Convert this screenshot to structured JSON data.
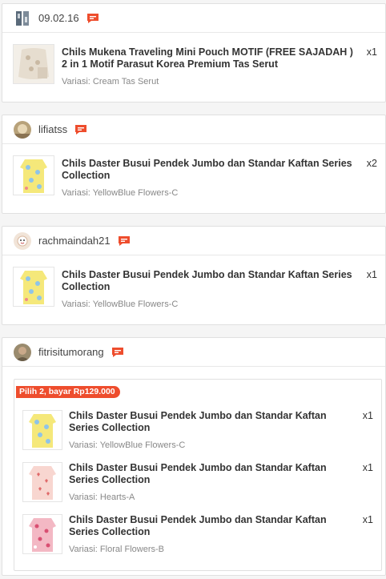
{
  "orders": [
    {
      "username": "09.02.16",
      "items": [
        {
          "name": "Chils Mukena Traveling Mini Pouch MOTIF (FREE SAJADAH ) 2 in 1 Motif Parasut Korea Premium Tas Serut",
          "qty": "x1",
          "variant": "Variasi: Cream Tas Serut"
        }
      ]
    },
    {
      "username": "lifiatss",
      "items": [
        {
          "name": "Chils Daster Busui Pendek Jumbo dan Standar Kaftan Series Collection",
          "qty": "x2",
          "variant": "Variasi: YellowBlue Flowers-C"
        }
      ]
    },
    {
      "username": "rachmaindah21",
      "items": [
        {
          "name": "Chils Daster Busui Pendek Jumbo dan Standar Kaftan Series Collection",
          "qty": "x1",
          "variant": "Variasi: YellowBlue Flowers-C"
        }
      ]
    },
    {
      "username": "fitrisitumorang",
      "bundle_tag": "Pilih 2, bayar Rp129.000",
      "items": [
        {
          "name": "Chils Daster Busui Pendek Jumbo dan Standar Kaftan Series Collection",
          "qty": "x1",
          "variant": "Variasi: YellowBlue Flowers-C"
        },
        {
          "name": "Chils Daster Busui Pendek Jumbo dan Standar Kaftan Series Collection",
          "qty": "x1",
          "variant": "Variasi: Hearts-A"
        },
        {
          "name": "Chils Daster Busui Pendek Jumbo dan Standar Kaftan Series Collection",
          "qty": "x1",
          "variant": "Variasi: Floral Flowers-B"
        }
      ]
    }
  ],
  "icons": {
    "chat": "chat-icon"
  },
  "colors": {
    "accent": "#ee4d2d"
  }
}
